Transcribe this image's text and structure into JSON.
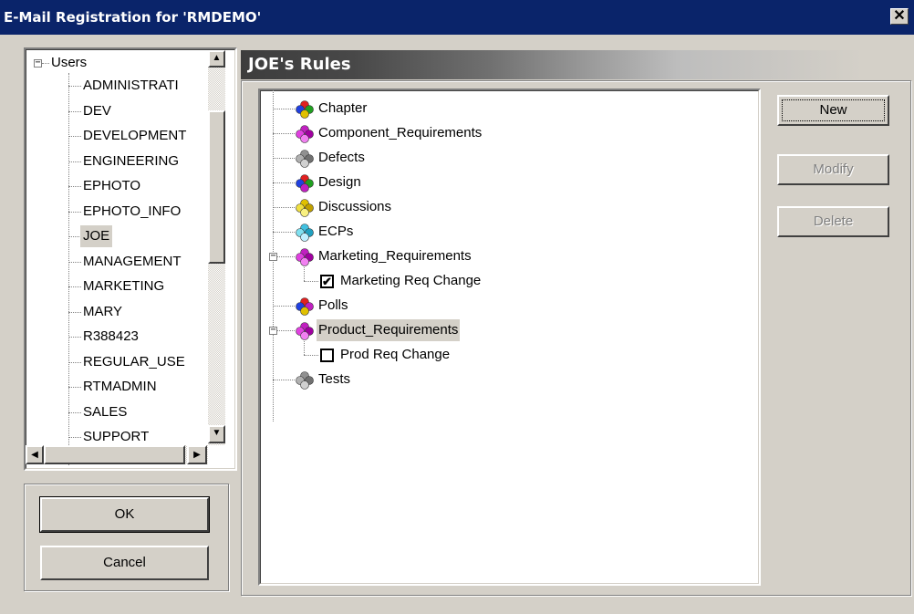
{
  "window": {
    "title": "E-Mail Registration for 'RMDEMO'",
    "close_glyph": "✕"
  },
  "users_tree": {
    "root_label": "Users",
    "items": [
      {
        "label": "ADMINISTRATI"
      },
      {
        "label": "DEV"
      },
      {
        "label": "DEVELOPMENT"
      },
      {
        "label": "ENGINEERING"
      },
      {
        "label": "EPHOTO"
      },
      {
        "label": "EPHOTO_INFO"
      },
      {
        "label": "JOE"
      },
      {
        "label": "MANAGEMENT"
      },
      {
        "label": "MARKETING"
      },
      {
        "label": "MARY"
      },
      {
        "label": "R388423"
      },
      {
        "label": "REGULAR_USE"
      },
      {
        "label": "RTMADMIN"
      },
      {
        "label": "SALES"
      },
      {
        "label": "SUPPORT"
      }
    ],
    "selected": "JOE"
  },
  "buttons": {
    "ok": "OK",
    "cancel": "Cancel",
    "new": "New",
    "modify": "Modify",
    "delete": "Delete"
  },
  "rules": {
    "header": "JOE's Rules",
    "items": [
      {
        "label": "Chapter",
        "icon": "multicolor-cube-icon",
        "colors": [
          "#e02020",
          "#2040e0",
          "#20a020",
          "#e0c000"
        ]
      },
      {
        "label": "Component_Requirements",
        "icon": "magenta-cube-icon",
        "colors": [
          "#c020c0",
          "#e040e0",
          "#a000a0",
          "#f080f0"
        ]
      },
      {
        "label": "Defects",
        "icon": "gray-cube-icon",
        "colors": [
          "#909090",
          "#b0b0b0",
          "#707070",
          "#d0d0d0"
        ]
      },
      {
        "label": "Design",
        "icon": "multicolor-cube-icon",
        "colors": [
          "#e02020",
          "#2040e0",
          "#20a020",
          "#c020c0"
        ]
      },
      {
        "label": "Discussions",
        "icon": "yellow-cube-icon",
        "colors": [
          "#e0c000",
          "#f0e040",
          "#c0a000",
          "#f8f080"
        ]
      },
      {
        "label": "ECPs",
        "icon": "cyan-cube-icon",
        "colors": [
          "#40c0e0",
          "#80e0f0",
          "#20a0c0",
          "#c0f0ff"
        ]
      },
      {
        "label": "Marketing_Requirements",
        "icon": "magenta-cube-icon",
        "colors": [
          "#c020c0",
          "#e040e0",
          "#a000a0",
          "#f080f0"
        ],
        "expanded": true,
        "children": [
          {
            "label": "Marketing Req Change",
            "checked": true
          }
        ]
      },
      {
        "label": "Polls",
        "icon": "multicolor-cube-icon",
        "colors": [
          "#e02020",
          "#2040e0",
          "#c020c0",
          "#e0c000"
        ]
      },
      {
        "label": "Product_Requirements",
        "icon": "magenta-cube-icon",
        "colors": [
          "#c020c0",
          "#e040e0",
          "#a000a0",
          "#f080f0"
        ],
        "expanded": true,
        "selected": true,
        "children": [
          {
            "label": "Prod Req Change",
            "checked": false
          }
        ]
      },
      {
        "label": "Tests",
        "icon": "gray-cube-icon",
        "colors": [
          "#909090",
          "#b0b0b0",
          "#707070",
          "#d0d0d0"
        ]
      }
    ]
  },
  "checkmark_glyph": "✔",
  "colors": {
    "titlebar": "#0a246a",
    "face": "#d4d0c8",
    "selection": "#d4d0c8"
  }
}
